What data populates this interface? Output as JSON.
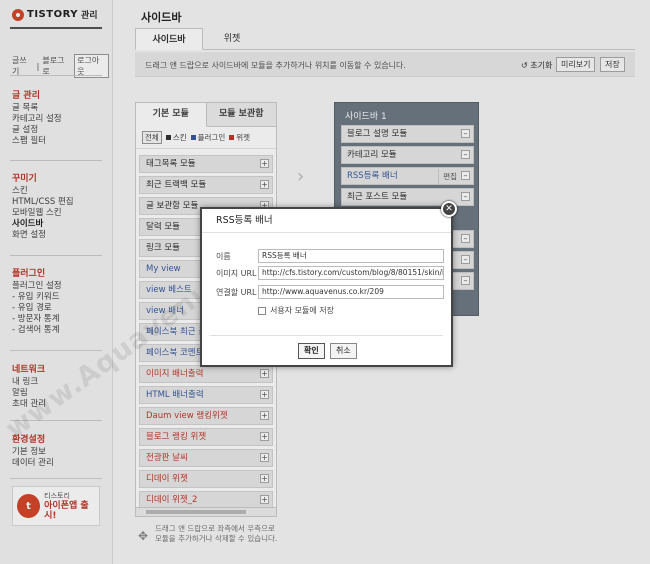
{
  "brand": {
    "name": "TISTORY",
    "suffix": "관리"
  },
  "userlinks": {
    "write": "글쓰기",
    "blog_home": "블로그로",
    "logout": "로그아웃"
  },
  "nav": [
    {
      "title": "글 관리",
      "items": [
        "글 목록",
        "카테고리 설정",
        "글 설정",
        "스팸 필터"
      ]
    },
    {
      "title": "꾸미기",
      "items": [
        "스킨",
        "HTML/CSS 편집",
        "모바일웹 스킨",
        "사이드바",
        "화면 설정"
      ]
    },
    {
      "title": "플러그인",
      "items": [
        "플러그인 설정",
        "- 유입 키워드",
        "- 유입 경로",
        "- 방문자 통계",
        "- 검색어 통계"
      ]
    },
    {
      "title": "네트워크",
      "items": [
        "내 링크",
        "알림",
        "초대 관리"
      ]
    },
    {
      "title": "환경설정",
      "items": [
        "기본 정보",
        "데이터 관리"
      ]
    }
  ],
  "promo": {
    "line1": "티스토리",
    "line2": "아이폰앱 출시!"
  },
  "page": {
    "title": "사이드바"
  },
  "tabs": [
    "사이드바",
    "위젯"
  ],
  "guide": {
    "text": "드래그 앤 드랍으로 사이드바에 모듈을 추가하거나 위치를 이동할 수 있습니다.",
    "reset": "초기화",
    "preview": "미리보기",
    "save": "저장"
  },
  "library": {
    "tabs": [
      "기본 모듈",
      "모듈 보관함"
    ],
    "filters": [
      {
        "label": "전체",
        "color": ""
      },
      {
        "label": "스킨",
        "color": "#333333"
      },
      {
        "label": "플러그인",
        "color": "#3a5ba0"
      },
      {
        "label": "위젯",
        "color": "#c0392b"
      }
    ],
    "modules": [
      {
        "label": "태그목록 모듈",
        "kind": "base"
      },
      {
        "label": "최근 트랙백 모듈",
        "kind": "base"
      },
      {
        "label": "글 보관함 모듈",
        "kind": "base"
      },
      {
        "label": "달력 모듈",
        "kind": "base"
      },
      {
        "label": "링크 모듈",
        "kind": "base"
      },
      {
        "label": "My view",
        "kind": "skin"
      },
      {
        "label": "view 베스트",
        "kind": "skin"
      },
      {
        "label": "view 배너",
        "kind": "skin"
      },
      {
        "label": "페이스북 최근 글",
        "kind": "skin"
      },
      {
        "label": "페이스북 코멘트",
        "kind": "skin"
      },
      {
        "label": "이미지 배너출력",
        "kind": "plugin"
      },
      {
        "label": "HTML 배너출력",
        "kind": "skin"
      },
      {
        "label": "Daum view 랭킹위젯",
        "kind": "plugin"
      },
      {
        "label": "블로그 랭킹 위젯",
        "kind": "plugin"
      },
      {
        "label": "전광판 날씨",
        "kind": "plugin"
      },
      {
        "label": "디데이 위젯",
        "kind": "plugin"
      },
      {
        "label": "디데이 위젯_2",
        "kind": "plugin"
      }
    ],
    "footer": [
      "드래그 앤 드랍으로 좌측에서 우측으로",
      "모듈을 추가하거나 삭제할 수 있습니다."
    ]
  },
  "sidebar_panel": {
    "title": "사이드바 1",
    "modules": [
      {
        "label": "블로그 설명 모듈",
        "edit": ""
      },
      {
        "label": "카테고리 모듈",
        "edit": ""
      },
      {
        "label": "RSS등록 배너",
        "edit": "편집"
      },
      {
        "label": "최근 포스트 모듈",
        "edit": ""
      }
    ]
  },
  "modal": {
    "title": "RSS등록 배너",
    "fields": [
      {
        "label": "이름",
        "value": "RSS등록 배너"
      },
      {
        "label": "이미지 URL",
        "value": "http://cfs.tistory.com/custom/blog/8/80151/skin/im"
      },
      {
        "label": "연결할 URL",
        "value": "http://www.aquavenus.co.kr/209"
      }
    ],
    "checkbox": "서용자 모듈에 저장",
    "confirm": "확인",
    "cancel": "취소"
  },
  "watermark": "www.Aquavenus.co.kr",
  "colors": {
    "brand": "#d5462a",
    "accent_red": "#c0392b",
    "skin_blue": "#3a5ba0",
    "panel_slate": "#6e7a86"
  }
}
